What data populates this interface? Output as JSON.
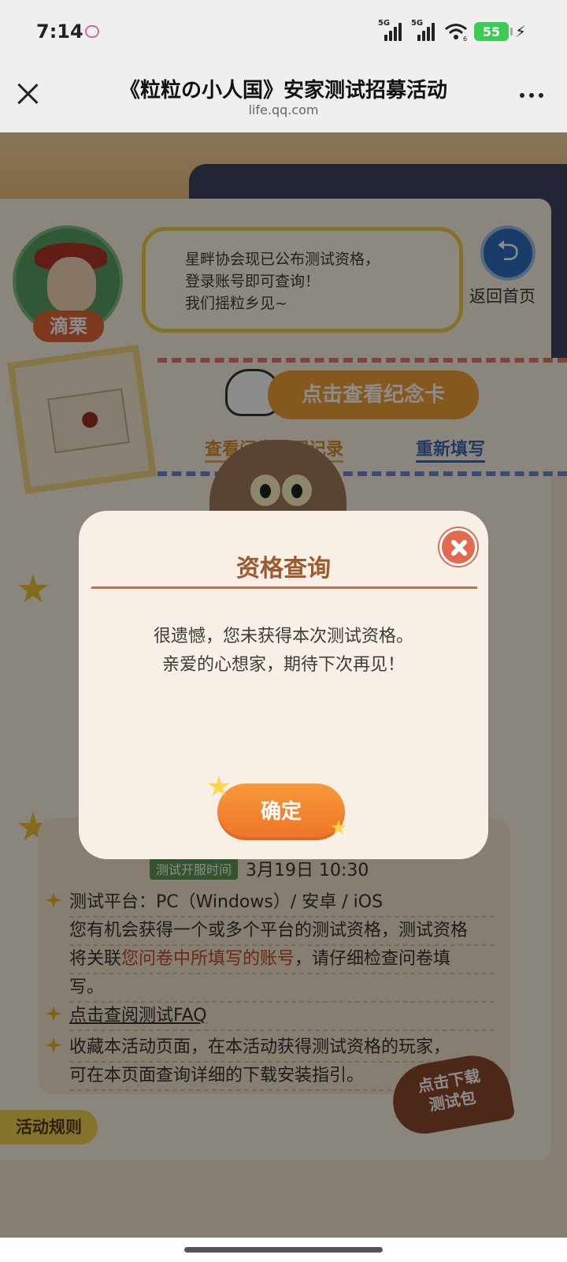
{
  "status_bar": {
    "time": "7:14",
    "network_1": "5G",
    "network_2": "5G",
    "wifi_badge": "6",
    "battery": "55"
  },
  "header": {
    "title": "《粒粒の小人国》安家测试招募活动",
    "subtitle": "life.qq.com"
  },
  "page": {
    "avatar_name": "滴栗",
    "bubble_text": [
      "星畔协会现已公布测试资格，",
      "登录账号即可查询！",
      "我们摇粒乡见~"
    ],
    "back_label": "返回首页",
    "memorial_card_button": "点击查看纪念卡",
    "view_record_link": "查看问卷填写记录",
    "refill_link": "重新填写",
    "time_tag": "测试开服时间",
    "time_value": "3月19日  10:30",
    "rules": {
      "platform": "测试平台：PC（Windows）/ 安卓 / iOS",
      "qualification_1": "您有机会获得一个或多个平台的测试资格，测试资格",
      "qualification_2_pre": "将关联",
      "qualification_2_accent": "您问卷中所填写的账号",
      "qualification_2_post": "，请仔细检查问卷填",
      "qualification_3": "写。",
      "faq": "点击查阅测试FAQ",
      "bookmark_1": "收藏本活动页面，在本活动获得测试资格的玩家，",
      "bookmark_2": "可在本页面查询详细的下载安装指引。"
    },
    "rules_tab": "活动规则",
    "download_badge": [
      "点击下载",
      "测试包"
    ]
  },
  "modal": {
    "title": "资格查询",
    "message_line_1": "很遗憾，您未获得本次测试资格。",
    "message_line_2": "亲爱的心想家，期待下次再见！",
    "confirm_label": "确定"
  }
}
